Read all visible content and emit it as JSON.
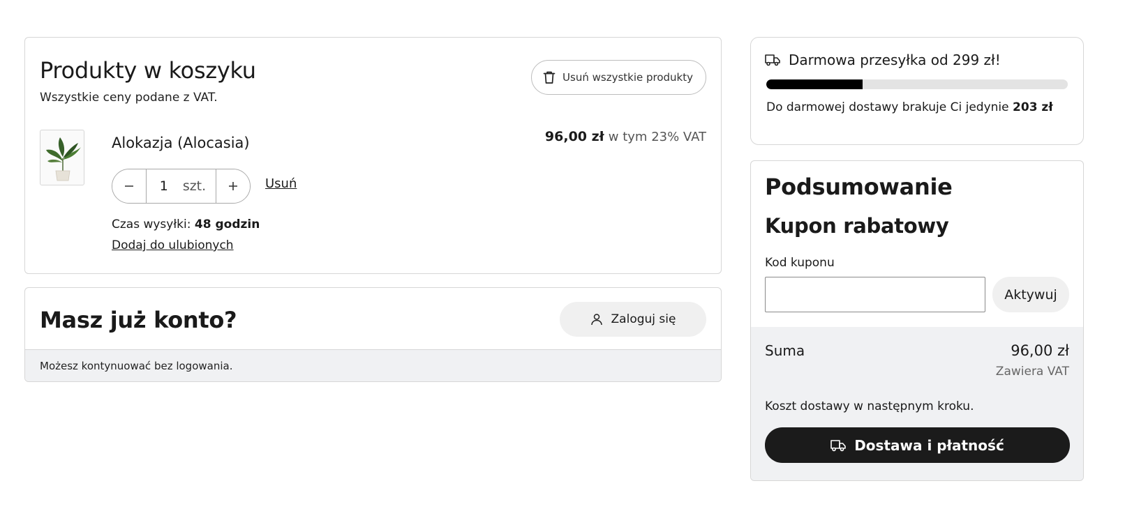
{
  "cart": {
    "title": "Produkty w koszyku",
    "subtitle": "Wszystkie ceny podane z VAT.",
    "clear_all_label": "Usuń wszystkie produkty",
    "items": [
      {
        "name": "Alokazja (Alocasia)",
        "price": "96,00 zł",
        "vat_note": "w tym 23% VAT",
        "quantity": "1",
        "unit": "szt.",
        "remove_label": "Usuń",
        "ship_time_label": "Czas wysyłki:",
        "ship_time_value": "48 godzin",
        "favorite_label": "Dodaj do ulubionych"
      }
    ]
  },
  "account": {
    "title": "Masz już konto?",
    "login_label": "Zaloguj się",
    "guest_note": "Możesz kontynuować bez logowania."
  },
  "shipping": {
    "title": "Darmowa przesyłka od 299 zł!",
    "progress_percent": 32,
    "note_prefix": "Do darmowej dostawy brakuje Ci jedynie",
    "note_amount": "203 zł"
  },
  "summary": {
    "title": "Podsumowanie",
    "coupon_title": "Kupon rabatowy",
    "coupon_label": "Kod kuponu",
    "coupon_value": "",
    "activate_label": "Aktywuj",
    "total_label": "Suma",
    "total_amount": "96,00 zł",
    "total_vat": "Zawiera VAT",
    "delivery_note": "Koszt dostawy w następnym kroku.",
    "checkout_label": "Dostawa i płatność"
  },
  "colors": {
    "primary": "#1b1b1b",
    "panel_gray": "#f0f1f3",
    "border": "#d6d6d6"
  }
}
